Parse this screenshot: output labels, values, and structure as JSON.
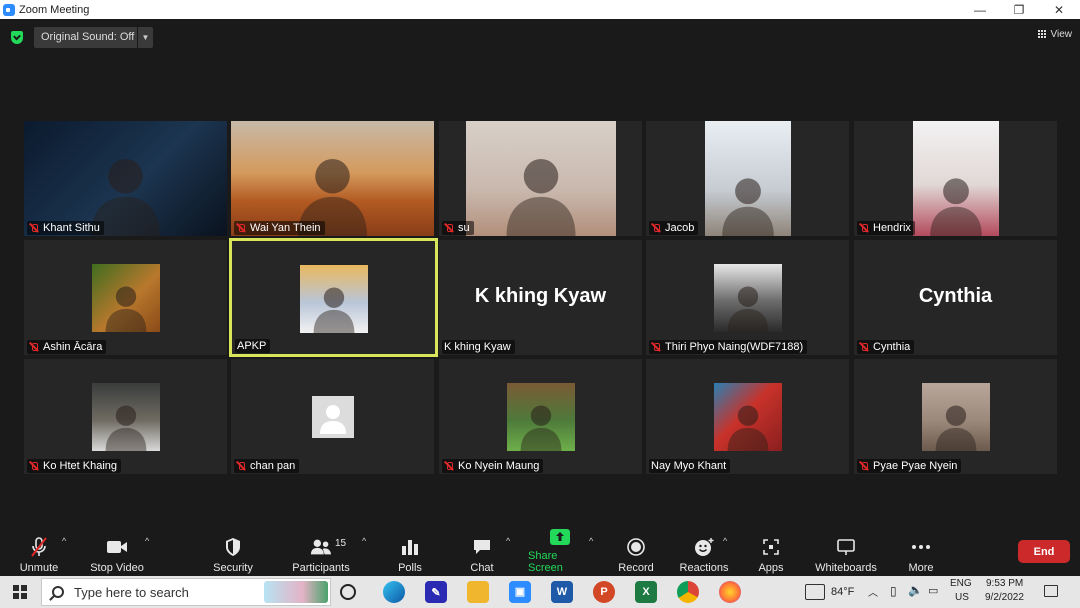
{
  "window": {
    "title": "Zoom Meeting",
    "minimize": "—",
    "maximize": "❐",
    "close": "✕"
  },
  "topbar": {
    "original_sound": "Original Sound: Off",
    "view_label": "View"
  },
  "tiles": [
    {
      "name": "Khant Sithu",
      "muted": true,
      "bg": "linear-gradient(135deg,#0b1a2e,#1c3550 55%,#0a121e)"
    },
    {
      "name": "Wai Yan Thein",
      "muted": true,
      "bg": "linear-gradient(180deg,#c7b9a7 0%,#d49a5d 45%,#b25a22 70%,#8a3d18 100%)"
    },
    {
      "name": "su",
      "muted": true,
      "bg": "linear-gradient(180deg,#d8d0c8,#c9b8ae 60%,#b28f7a)"
    },
    {
      "name": "Jacob",
      "muted": true,
      "bg": "linear-gradient(180deg,#e9eef3,#c6ccd2 60%,#8f8479)"
    },
    {
      "name": "Hendrix",
      "muted": true,
      "bg": "linear-gradient(180deg,#f2f2f2,#e1d8d6 55%,#b34a5c)"
    },
    {
      "name": "Ashin Ācāra",
      "muted": true,
      "bg": "linear-gradient(135deg,#3f6d1f,#b8782d 55%,#8a4a17)"
    },
    {
      "name": "APKP",
      "muted": false,
      "active": true,
      "bg": "linear-gradient(180deg,#e9b85f,#b9c5d8 55%,#f2f2f2)"
    },
    {
      "name": "K khing Kyaw",
      "muted": false,
      "big": "K khing Kyaw"
    },
    {
      "name": "Thiri Phyo Naing(WDF7188)",
      "muted": true,
      "bg": "linear-gradient(180deg,#e7e7e7,#6a6a6a 55%,#2b2b2b)"
    },
    {
      "name": "Cynthia",
      "muted": true,
      "big": "Cynthia"
    },
    {
      "name": "Ko Htet Khaing",
      "muted": true,
      "bg": "linear-gradient(180deg,#3a3d3c,#6f6b62 55%,#d9d9d9)"
    },
    {
      "name": "chan pan",
      "muted": true,
      "bg": "linear-gradient(180deg,#e4e4e4,#cfcfcf)"
    },
    {
      "name": "Ko Nyein Maung",
      "muted": true,
      "bg": "linear-gradient(180deg,#7a5a35,#4e7a3a 55%,#6eb04a)"
    },
    {
      "name": "Nay Myo Khant",
      "muted": false,
      "bg": "linear-gradient(135deg,#2a7fb2,#c8322a 45%,#8a1f1f)"
    },
    {
      "name": "Pyae Pyae Nyein",
      "muted": true,
      "bg": "linear-gradient(180deg,#b8a69a,#9b8a7c 55%,#6d5a4e)"
    }
  ],
  "toolbar": {
    "unmute": "Unmute",
    "stop_video": "Stop Video",
    "security": "Security",
    "participants": "Participants",
    "participants_count": "15",
    "polls": "Polls",
    "chat": "Chat",
    "share_screen": "Share Screen",
    "record": "Record",
    "reactions": "Reactions",
    "apps": "Apps",
    "whiteboards": "Whiteboards",
    "more": "More",
    "end": "End",
    "caret": "^"
  },
  "taskbar": {
    "search_placeholder": "Type here to search",
    "temperature": "84°F",
    "lang_top": "ENG",
    "lang_bottom": "US",
    "time": "9:53 PM",
    "date": "9/2/2022"
  },
  "colors": {
    "accent_green": "#23d959",
    "end_red": "#cc2a2a",
    "active_border": "#d9e65b"
  }
}
